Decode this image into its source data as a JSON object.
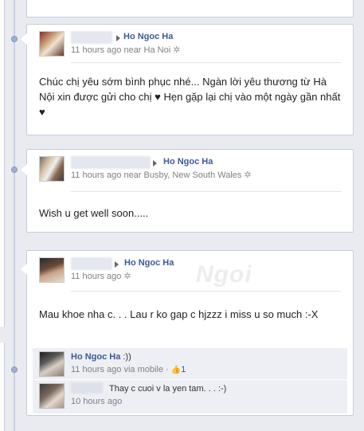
{
  "posts": [
    {
      "author": "Ho Ngoc Ha",
      "time": "11 hours ago near Ha Noi",
      "text": "Chúc chị yêu sớm bình phục nhé... Ngàn lời yêu thương từ Hà Nội xin được gửi cho chị ♥ Hẹn gặp lại chị vào một ngày gần nhất ♥"
    },
    {
      "author": "Ho Ngoc Ha",
      "time": "11 hours ago near Busby, New South Wales",
      "text": "Wish u get well soon....."
    },
    {
      "author": "Ho Ngoc Ha",
      "time": "11 hours ago",
      "text": "Mau khoe nha c. . . Lau r ko gap c hjzzz i miss u so much :-X",
      "comments": [
        {
          "author": "Ho Ngoc Ha",
          "text": ":))",
          "time": "11 hours ago via mobile ·",
          "likes": "1"
        },
        {
          "text": "Thay c cuoi v la yen tam. . . :-)",
          "time": "10 hours ago"
        }
      ]
    }
  ],
  "watermark": "Ngoi",
  "icons": {
    "gear": "gear-icon",
    "arrow": "triangle-right-icon",
    "like": "thumbs-up-icon"
  }
}
